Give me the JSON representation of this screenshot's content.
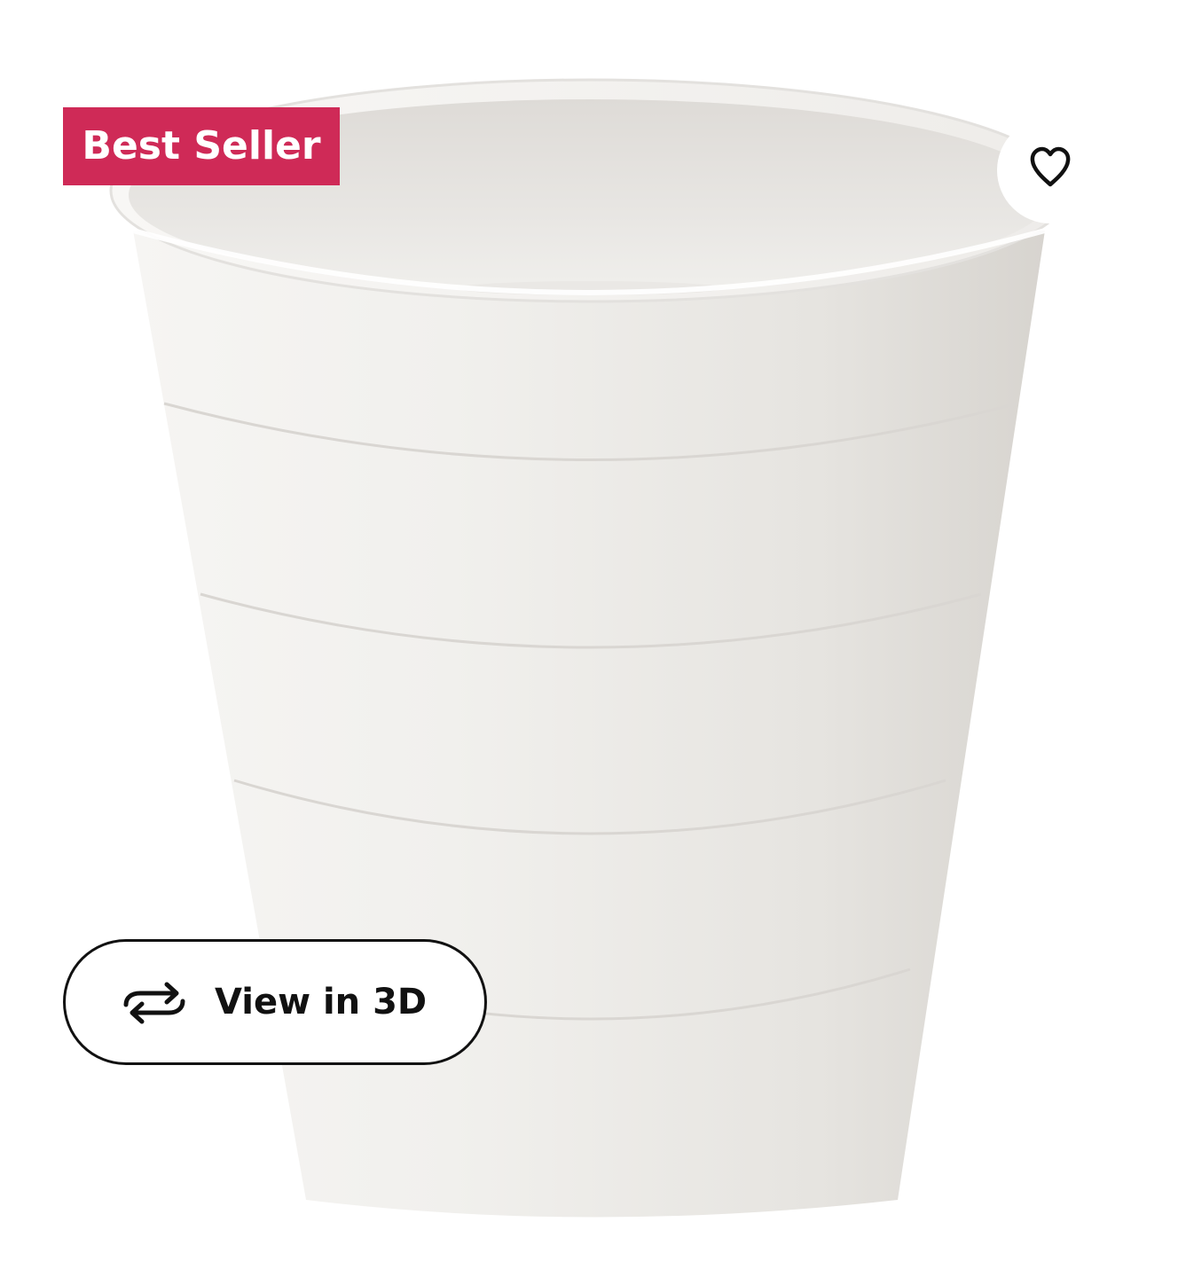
{
  "product": {
    "image_subject": "waste-bin-icon",
    "badge_label": "Best Seller",
    "badge_color": "#cf2a57",
    "favourite_icon": "heart-icon",
    "view_3d_label": "View in 3D",
    "view_3d_icon": "rotate-3d-icon"
  }
}
